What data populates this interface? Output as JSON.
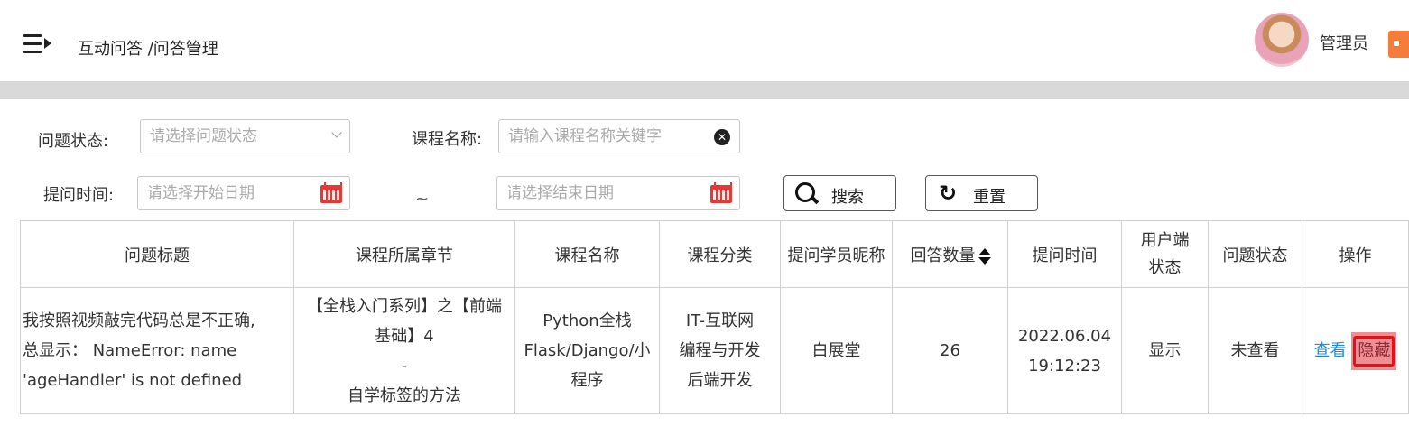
{
  "header": {
    "breadcrumb": "互动问答 /问答管理",
    "admin_name": "管理员"
  },
  "filters": {
    "status_label": "问题状态:",
    "status_placeholder": "请选择问题状态",
    "course_label": "课程名称:",
    "course_placeholder": "请输入课程名称关键字",
    "time_label": "提问时间:",
    "start_placeholder": "请选择开始日期",
    "range_sep": "~",
    "end_placeholder": "请选择结束日期",
    "search_label": "搜索",
    "reset_label": "重置"
  },
  "table": {
    "headers": [
      "问题标题",
      "课程所属章节",
      "课程名称",
      "课程分类",
      "提问学员昵称",
      "回答数量",
      "提问时间",
      "用户端状态",
      "问题状态",
      "操作"
    ],
    "rows": [
      {
        "title_lines": [
          "我按照视频敲完代码总是不正确,",
          "总显示： NameError: name",
          "'ageHandler' is not defined"
        ],
        "chapter_lines": [
          "【全栈入门系列】之【前端",
          "基础】4",
          "-",
          "自学标签的方法"
        ],
        "course_lines": [
          "Python全栈",
          "Flask/Django/小",
          "程序"
        ],
        "category_lines": [
          "IT-互联网",
          "编程与开发",
          "后端开发"
        ],
        "student": "白展堂",
        "answers": "26",
        "time_lines": [
          "2022.06.04",
          "19:12:23"
        ],
        "client_status": "显示",
        "question_status": "未查看",
        "action_view": "查看",
        "action_hide": "隐藏"
      }
    ]
  },
  "colors": {
    "link": "#1e8fd6",
    "highlight_border": "#e0131b",
    "highlight_fill": "#f08e93",
    "accent_tab": "#f57c3b"
  }
}
